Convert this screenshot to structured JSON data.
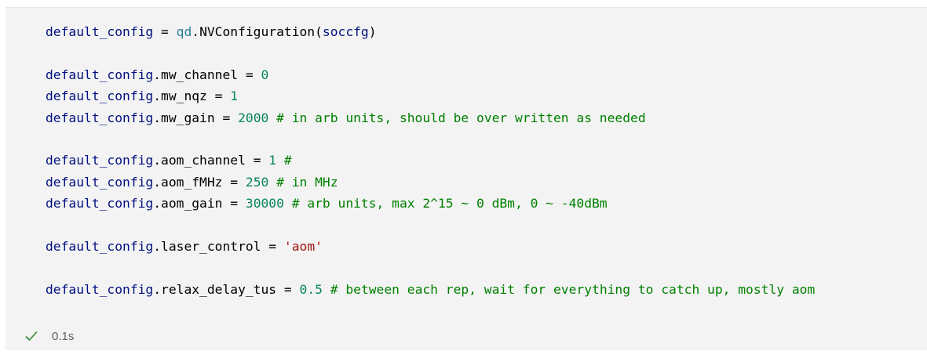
{
  "cell": {
    "lines": [
      [
        {
          "t": "default_config",
          "c": "var"
        },
        {
          "t": " = ",
          "c": "op"
        },
        {
          "t": "qd",
          "c": "cls"
        },
        {
          "t": ".NVConfiguration(",
          "c": "fn"
        },
        {
          "t": "soccfg",
          "c": "var"
        },
        {
          "t": ")",
          "c": "fn"
        }
      ],
      [],
      [
        {
          "t": "default_config",
          "c": "var"
        },
        {
          "t": ".",
          "c": "op"
        },
        {
          "t": "mw_channel",
          "c": "fn"
        },
        {
          "t": " = ",
          "c": "op"
        },
        {
          "t": "0",
          "c": "num"
        }
      ],
      [
        {
          "t": "default_config",
          "c": "var"
        },
        {
          "t": ".",
          "c": "op"
        },
        {
          "t": "mw_nqz",
          "c": "fn"
        },
        {
          "t": " = ",
          "c": "op"
        },
        {
          "t": "1",
          "c": "num"
        }
      ],
      [
        {
          "t": "default_config",
          "c": "var"
        },
        {
          "t": ".",
          "c": "op"
        },
        {
          "t": "mw_gain",
          "c": "fn"
        },
        {
          "t": " = ",
          "c": "op"
        },
        {
          "t": "2000",
          "c": "num"
        },
        {
          "t": " # in arb units, should be over written as needed",
          "c": "cmt"
        }
      ],
      [],
      [
        {
          "t": "default_config",
          "c": "var"
        },
        {
          "t": ".",
          "c": "op"
        },
        {
          "t": "aom_channel",
          "c": "fn"
        },
        {
          "t": " = ",
          "c": "op"
        },
        {
          "t": "1",
          "c": "num"
        },
        {
          "t": " #",
          "c": "cmt"
        }
      ],
      [
        {
          "t": "default_config",
          "c": "var"
        },
        {
          "t": ".",
          "c": "op"
        },
        {
          "t": "aom_fMHz",
          "c": "fn"
        },
        {
          "t": " = ",
          "c": "op"
        },
        {
          "t": "250",
          "c": "num"
        },
        {
          "t": " # in MHz",
          "c": "cmt"
        }
      ],
      [
        {
          "t": "default_config",
          "c": "var"
        },
        {
          "t": ".",
          "c": "op"
        },
        {
          "t": "aom_gain",
          "c": "fn"
        },
        {
          "t": " = ",
          "c": "op"
        },
        {
          "t": "30000",
          "c": "num"
        },
        {
          "t": " # arb units, max 2^15 ~ 0 dBm, 0 ~ -40dBm",
          "c": "cmt"
        }
      ],
      [],
      [
        {
          "t": "default_config",
          "c": "var"
        },
        {
          "t": ".",
          "c": "op"
        },
        {
          "t": "laser_control",
          "c": "fn"
        },
        {
          "t": " = ",
          "c": "op"
        },
        {
          "t": "'aom'",
          "c": "str"
        }
      ],
      [],
      [
        {
          "t": "default_config",
          "c": "var"
        },
        {
          "t": ".",
          "c": "op"
        },
        {
          "t": "relax_delay_tus",
          "c": "fn"
        },
        {
          "t": " = ",
          "c": "op"
        },
        {
          "t": "0.5",
          "c": "num"
        },
        {
          "t": " # between each rep, wait for everything to catch up, mostly aom",
          "c": "cmt"
        }
      ]
    ],
    "status": {
      "icon": "checkmark-icon",
      "duration": "0.1s",
      "check_color": "#388a34"
    }
  }
}
